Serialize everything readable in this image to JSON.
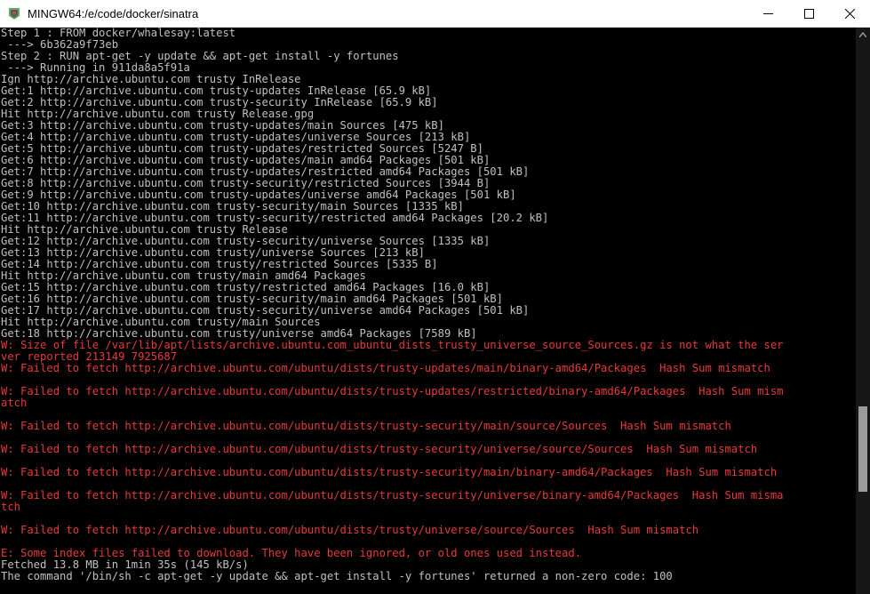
{
  "window": {
    "title": "MINGW64:/e/code/docker/sinatra",
    "app_icon": "mingw-terminal-icon",
    "controls": {
      "minimize": "minimize-icon",
      "maximize": "maximize-icon",
      "close": "close-icon"
    }
  },
  "colors": {
    "background": "#000000",
    "normal_text": "#c0c0c0",
    "error_text": "#e63a3a"
  },
  "terminal": {
    "lines": [
      {
        "text": "Step 1 : FROM docker/whalesay:latest",
        "style": "w"
      },
      {
        "text": " ---> 6b362a9f73eb",
        "style": "w"
      },
      {
        "text": "Step 2 : RUN apt-get -y update && apt-get install -y fortunes",
        "style": "w"
      },
      {
        "text": " ---> Running in 911da8a5f91a",
        "style": "w"
      },
      {
        "text": "Ign http://archive.ubuntu.com trusty InRelease",
        "style": "w"
      },
      {
        "text": "Get:1 http://archive.ubuntu.com trusty-updates InRelease [65.9 kB]",
        "style": "w"
      },
      {
        "text": "Get:2 http://archive.ubuntu.com trusty-security InRelease [65.9 kB]",
        "style": "w"
      },
      {
        "text": "Hit http://archive.ubuntu.com trusty Release.gpg",
        "style": "w"
      },
      {
        "text": "Get:3 http://archive.ubuntu.com trusty-updates/main Sources [475 kB]",
        "style": "w"
      },
      {
        "text": "Get:4 http://archive.ubuntu.com trusty-updates/universe Sources [213 kB]",
        "style": "w"
      },
      {
        "text": "Get:5 http://archive.ubuntu.com trusty-updates/restricted Sources [5247 B]",
        "style": "w"
      },
      {
        "text": "Get:6 http://archive.ubuntu.com trusty-updates/main amd64 Packages [501 kB]",
        "style": "w"
      },
      {
        "text": "Get:7 http://archive.ubuntu.com trusty-updates/restricted amd64 Packages [501 kB]",
        "style": "w"
      },
      {
        "text": "Get:8 http://archive.ubuntu.com trusty-security/restricted Sources [3944 B]",
        "style": "w"
      },
      {
        "text": "Get:9 http://archive.ubuntu.com trusty-updates/universe amd64 Packages [501 kB]",
        "style": "w"
      },
      {
        "text": "Get:10 http://archive.ubuntu.com trusty-security/main Sources [1335 kB]",
        "style": "w"
      },
      {
        "text": "Get:11 http://archive.ubuntu.com trusty-security/restricted amd64 Packages [20.2 kB]",
        "style": "w"
      },
      {
        "text": "Hit http://archive.ubuntu.com trusty Release",
        "style": "w"
      },
      {
        "text": "Get:12 http://archive.ubuntu.com trusty-security/universe Sources [1335 kB]",
        "style": "w"
      },
      {
        "text": "Get:13 http://archive.ubuntu.com trusty/universe Sources [213 kB]",
        "style": "w"
      },
      {
        "text": "Get:14 http://archive.ubuntu.com trusty/restricted Sources [5335 B]",
        "style": "w"
      },
      {
        "text": "Hit http://archive.ubuntu.com trusty/main amd64 Packages",
        "style": "w"
      },
      {
        "text": "Get:15 http://archive.ubuntu.com trusty/restricted amd64 Packages [16.0 kB]",
        "style": "w"
      },
      {
        "text": "Get:16 http://archive.ubuntu.com trusty-security/main amd64 Packages [501 kB]",
        "style": "w"
      },
      {
        "text": "Get:17 http://archive.ubuntu.com trusty-security/universe amd64 Packages [501 kB]",
        "style": "w"
      },
      {
        "text": "Hit http://archive.ubuntu.com trusty/main Sources",
        "style": "w"
      },
      {
        "text": "Get:18 http://archive.ubuntu.com trusty/universe amd64 Packages [7589 kB]",
        "style": "w"
      },
      {
        "text": "W: Size of file /var/lib/apt/lists/archive.ubuntu.com_ubuntu_dists_trusty_universe_source_Sources.gz is not what the ser",
        "style": "r"
      },
      {
        "text": "ver reported 213149 7925687",
        "style": "r"
      },
      {
        "text": "W: Failed to fetch http://archive.ubuntu.com/ubuntu/dists/trusty-updates/main/binary-amd64/Packages  Hash Sum mismatch",
        "style": "r"
      },
      {
        "text": "",
        "style": "r"
      },
      {
        "text": "W: Failed to fetch http://archive.ubuntu.com/ubuntu/dists/trusty-updates/restricted/binary-amd64/Packages  Hash Sum mism",
        "style": "r"
      },
      {
        "text": "atch",
        "style": "r"
      },
      {
        "text": "",
        "style": "r"
      },
      {
        "text": "W: Failed to fetch http://archive.ubuntu.com/ubuntu/dists/trusty-security/main/source/Sources  Hash Sum mismatch",
        "style": "r"
      },
      {
        "text": "",
        "style": "r"
      },
      {
        "text": "W: Failed to fetch http://archive.ubuntu.com/ubuntu/dists/trusty-security/universe/source/Sources  Hash Sum mismatch",
        "style": "r"
      },
      {
        "text": "",
        "style": "r"
      },
      {
        "text": "W: Failed to fetch http://archive.ubuntu.com/ubuntu/dists/trusty-security/main/binary-amd64/Packages  Hash Sum mismatch",
        "style": "r"
      },
      {
        "text": "",
        "style": "r"
      },
      {
        "text": "W: Failed to fetch http://archive.ubuntu.com/ubuntu/dists/trusty-security/universe/binary-amd64/Packages  Hash Sum misma",
        "style": "r"
      },
      {
        "text": "tch",
        "style": "r"
      },
      {
        "text": "",
        "style": "r"
      },
      {
        "text": "W: Failed to fetch http://archive.ubuntu.com/ubuntu/dists/trusty/universe/source/Sources  Hash Sum mismatch",
        "style": "r"
      },
      {
        "text": "",
        "style": "r"
      },
      {
        "text": "E: Some index files failed to download. They have been ignored, or old ones used instead.",
        "style": "r"
      },
      {
        "text": "Fetched 13.8 MB in 1min 35s (145 kB/s)",
        "style": "w"
      },
      {
        "text": "The command '/bin/sh -c apt-get -y update && apt-get install -y fortunes' returned a non-zero code: 100",
        "style": "w"
      }
    ]
  },
  "scrollbar": {
    "up_arrow": "scroll-up-arrow-icon",
    "position_fraction": 0.69
  }
}
